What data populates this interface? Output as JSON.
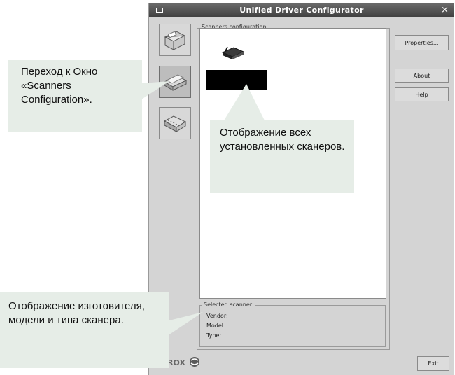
{
  "window": {
    "title": "Unified Driver Configurator",
    "close_glyph": "×"
  },
  "sidebar": {
    "items": [
      {
        "icon": "printer-icon"
      },
      {
        "icon": "scanner-icon"
      },
      {
        "icon": "port-icon"
      }
    ]
  },
  "scanners_group": {
    "title": "Scanners configuration"
  },
  "buttons": {
    "properties": "Properties...",
    "about": "About",
    "help": "Help",
    "exit": "Exit"
  },
  "selected_scanner": {
    "title": "Selected scanner:",
    "vendor_label": "Vendor:",
    "model_label": "Model:",
    "type_label": "Type:"
  },
  "footer": {
    "logo": "XEROX"
  },
  "callouts": {
    "nav": "Переход к Окно «Scanners Configuration».",
    "list": "Отображение всех установленных сканеров.",
    "info": "Отображение изготовителя, модели и типа сканера."
  },
  "colors": {
    "callout_bg": "#e6ede7",
    "titlebar": "#4a4a4a",
    "window_bg": "#d4d4d4"
  }
}
